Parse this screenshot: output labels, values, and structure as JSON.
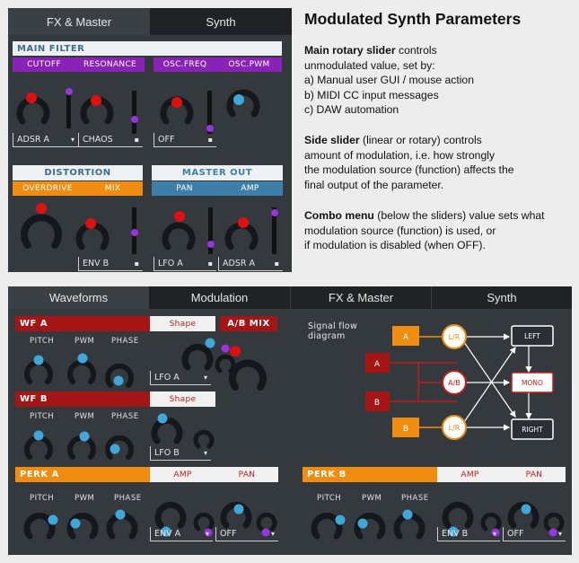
{
  "top_panel": {
    "tabs": [
      "FX & Master",
      "Synth"
    ],
    "main_filter": {
      "title": "MAIN FILTER",
      "subs": [
        "CUTOFF",
        "RESONANCE",
        "OSC.FREQ",
        "OSC.PWM"
      ],
      "combos": [
        "ADSR A",
        "CHAOS",
        "OFF"
      ]
    },
    "distortion": {
      "title": "DISTORTION",
      "subs": [
        "OVERDRIVE",
        "MIX"
      ],
      "combo": "ENV B"
    },
    "master_out": {
      "title": "MASTER OUT",
      "subs": [
        "PAN",
        "AMP"
      ],
      "combos": [
        "LFO A",
        "ADSR A"
      ]
    }
  },
  "description": {
    "heading": "Modulated Synth Parameters",
    "p1_bold": "Main rotary slider",
    "p1_lines": [
      " controls",
      "unmodulated value, set by:",
      "a) Manual user GUI / mouse action",
      "b) MIDI CC input messages",
      "c) DAW automation"
    ],
    "p2_bold": "Side slider",
    "p2_lines": [
      " (linear or rotary) controls",
      "amount of modulation, i.e. how strongly",
      "the modulation source (function) affects the",
      "final output of the parameter."
    ],
    "p3_bold": "Combo menu",
    "p3_lines": [
      " (below the sliders) value sets what",
      "modulation source (function) is used, or",
      "if modulation is disabled (when OFF)."
    ]
  },
  "bottom_panel": {
    "tabs": [
      "Waveforms",
      "Modulation",
      "FX & Master",
      "Synth"
    ],
    "wf_a": {
      "title": "WF A",
      "shape": "Shape",
      "params": [
        "PITCH",
        "PWM",
        "PHASE"
      ],
      "combo": "LFO A"
    },
    "ab_mix": "A/B MIX",
    "wf_b": {
      "title": "WF B",
      "shape": "Shape",
      "params": [
        "PITCH",
        "PWM",
        "PHASE"
      ],
      "combo": "LFO B"
    },
    "perk_a": {
      "title": "PERK A",
      "subs": [
        "AMP",
        "PAN"
      ],
      "params": [
        "PITCH",
        "PWM",
        "PHASE"
      ],
      "combos": [
        "ENV A",
        "OFF"
      ]
    },
    "perk_b": {
      "title": "PERK B",
      "subs": [
        "AMP",
        "PAN"
      ],
      "params": [
        "PITCH",
        "PWM",
        "PHASE"
      ],
      "combos": [
        "ENV B",
        "OFF"
      ]
    },
    "flow": {
      "caption_line1": "Signal flow",
      "caption_line2": "diagram",
      "node_a_orange": "A",
      "node_a_red": "A",
      "node_b_red": "B",
      "node_b_orange": "B",
      "lr_top": "L/R",
      "ab_mid": "A/B",
      "lr_bot": "L/R",
      "left": "LEFT",
      "mono": "MONO",
      "right": "RIGHT"
    }
  },
  "colors": {
    "panel": "#34393e",
    "purple": "#8b22b8",
    "red": "#a51516",
    "orange": "#f08c10",
    "blue": "#3d7fa8",
    "knob_red": "#e01010",
    "knob_blue": "#41a6d8",
    "knob_violet": "#9a33e0"
  }
}
